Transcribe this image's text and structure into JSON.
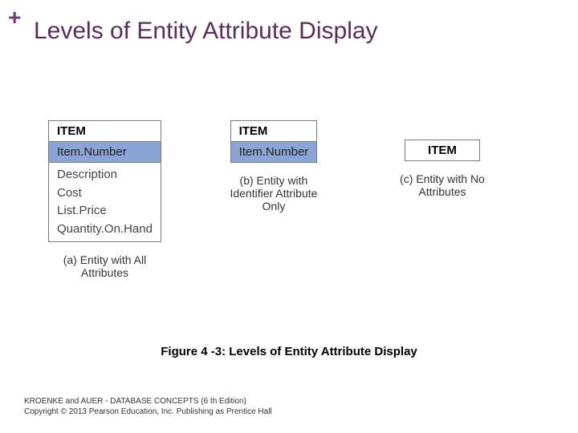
{
  "header": {
    "plus": "+",
    "title": "Levels of Entity Attribute Display"
  },
  "diagram": {
    "colA": {
      "head": "ITEM",
      "identifier": "Item.Number",
      "attributes": "Description\nCost\nList.Price\nQuantity.On.Hand",
      "caption": "(a) Entity with All Attributes"
    },
    "colB": {
      "head": "ITEM",
      "identifier": "Item.Number",
      "caption": "(b) Entity with Identifier Attribute Only"
    },
    "colC": {
      "head": "ITEM",
      "caption": "(c) Entity with No Attributes"
    }
  },
  "figure_label": "Figure  4 -3: Levels of Entity Attribute Display",
  "footer": {
    "line1": "KROENKE and AUER -  DATABASE CONCEPTS (6 th Edition)",
    "line2": "Copyright © 2013 Pearson Education, Inc. Publishing as Prentice Hall"
  }
}
